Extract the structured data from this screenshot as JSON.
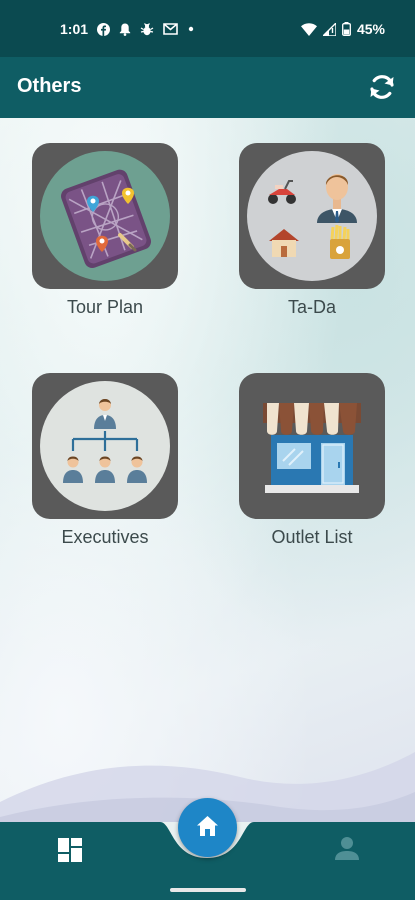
{
  "status_bar": {
    "time": "1:01",
    "battery": "45%",
    "icons": [
      "facebook-icon",
      "notification-bell-icon",
      "bug-icon",
      "gmail-icon",
      "dot-icon",
      "wifi-icon",
      "signal-icon",
      "battery-icon"
    ]
  },
  "app_bar": {
    "title": "Others",
    "refresh_icon": "refresh-icon"
  },
  "tiles": [
    {
      "label": "Tour Plan",
      "icon": "map-location-icon"
    },
    {
      "label": "Ta-Da",
      "icon": "travel-allowance-icon"
    },
    {
      "label": "Executives",
      "icon": "org-chart-icon"
    },
    {
      "label": "Outlet List",
      "icon": "store-icon"
    }
  ],
  "bottom_nav": {
    "items": [
      "dashboard-icon",
      "home-icon",
      "profile-icon"
    ]
  },
  "colors": {
    "status_bar": "#0b4a50",
    "app_bar": "#0f5d64",
    "tile_bg": "#5a5a5a",
    "fab": "#1e86c7",
    "nav_bg": "#0f5d64"
  }
}
